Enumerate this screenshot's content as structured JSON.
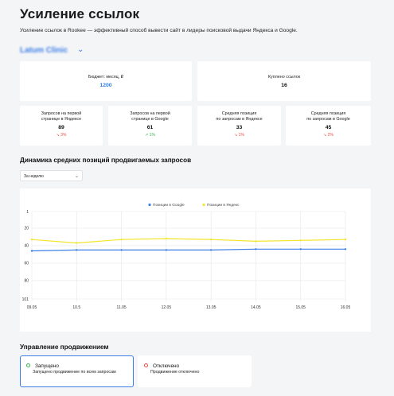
{
  "page": {
    "title": "Усиление ссылок",
    "subtitle": "Усиление ссылок в Rookee — эффективный способ вывести сайт в лидеры поисковой выдачи Яндекса и Google.",
    "project_name": "Latum Clinic",
    "project_chevron": "⌄"
  },
  "stats_top": [
    {
      "label": "Бюджет: месяц, ₽",
      "value": "1200"
    },
    {
      "label": "Куплено ссылок",
      "value": "16"
    }
  ],
  "stats_small": [
    {
      "label1": "Запросов на первой",
      "label2": "странице в Яндексе",
      "value": "89",
      "delta": "3%",
      "trend": "down"
    },
    {
      "label1": "Запросов на первой",
      "label2": "странице в Google",
      "value": "61",
      "delta": "1%",
      "trend": "up"
    },
    {
      "label1": "Средняя позиция",
      "label2": "по запросам в Яндексе",
      "value": "33",
      "delta": "1%",
      "trend": "down"
    },
    {
      "label1": "Средняя позиция",
      "label2": "по запросам в Google",
      "value": "45",
      "delta": "2%",
      "trend": "down"
    }
  ],
  "dynamics": {
    "title": "Динамика средних позиций продвигаемых запросов",
    "period_select": "За неделю"
  },
  "chart_data": {
    "type": "line",
    "x": [
      "09.05",
      "10.5",
      "11.05",
      "12.05",
      "13.05",
      "14.05",
      "15.05",
      "16.05"
    ],
    "y_ticks": [
      "1",
      "20",
      "40",
      "60",
      "80",
      "101"
    ],
    "y_tick_values": [
      1,
      20,
      40,
      60,
      80,
      101
    ],
    "ylim": [
      1,
      101
    ],
    "y_inverted": true,
    "grid": true,
    "legend_position": "top-center",
    "series": [
      {
        "name": "Позиции в Google",
        "color": "#3d7fe6",
        "values": [
          46,
          45,
          45,
          45,
          45,
          44,
          44,
          44
        ]
      },
      {
        "name": "Позиции в Яндекс",
        "color": "#f3e52a",
        "values": [
          33,
          37,
          33,
          32,
          33,
          35,
          34,
          33
        ]
      }
    ]
  },
  "management": {
    "title": "Управление продвижением",
    "options": [
      {
        "title": "Запущено",
        "desc": "Запущено продвижение по всем запросам",
        "status_color": "#3bb54a"
      },
      {
        "title": "Отключено",
        "desc": "Продвижение отключено",
        "status_color": "#e84a3c"
      }
    ]
  }
}
